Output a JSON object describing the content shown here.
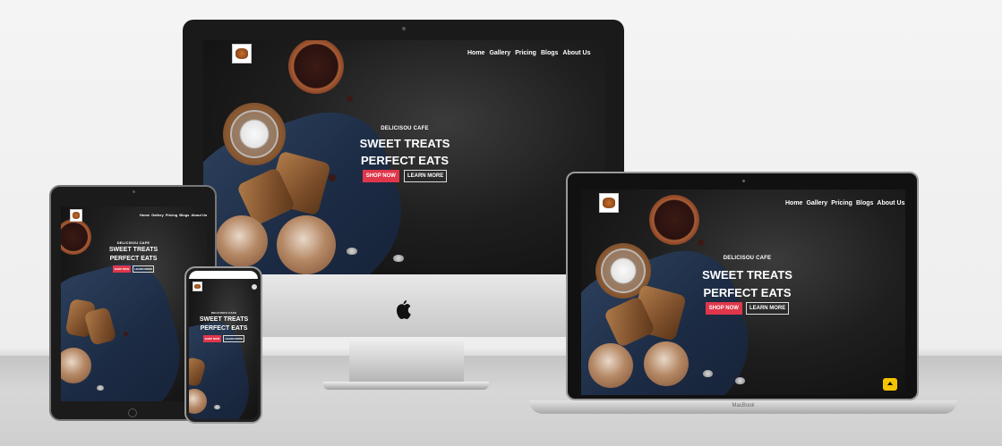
{
  "site": {
    "nav": [
      "Home",
      "Gallery",
      "Pricing",
      "Blogs",
      "About Us"
    ],
    "brand": "DELICISOU CAFE",
    "headline_1": "SWEET TREATS",
    "headline_2": "PERFECT EATS",
    "shop_label": "SHOP NOW",
    "learn_label": "LEARN MORE"
  },
  "devices": {
    "laptop_label": "MacBook",
    "scroll_top_icon": "arrow-up-icon"
  },
  "colors": {
    "primary_button": "#e0364b",
    "scroll_button": "#f4c400",
    "background_dark": "#1f1f1f"
  }
}
